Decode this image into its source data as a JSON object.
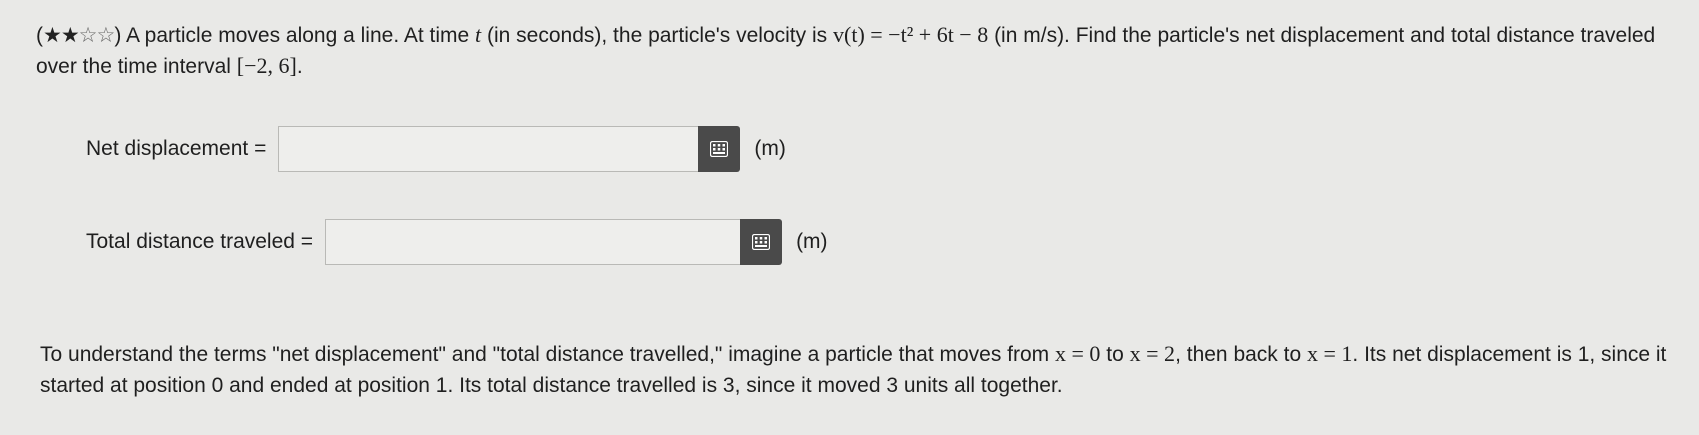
{
  "question": {
    "difficulty": {
      "filled": "★★",
      "empty": "☆☆"
    },
    "text_before_t": "A particle moves along a line. At time",
    "var_t": "t",
    "text_after_t": "(in seconds), the particle's velocity is",
    "velocity_formula": "v(t) = −t² + 6t − 8",
    "text_after_formula": "(in m/s). Find the particle's net displacement and total distance traveled over the time interval",
    "interval": "[−2, 6]",
    "end_punct": "."
  },
  "net": {
    "label": "Net displacement =",
    "value": "",
    "unit": "(m)"
  },
  "total": {
    "label": "Total distance traveled =",
    "value": "",
    "unit": "(m)"
  },
  "hint": {
    "part1": "To understand the terms \"net displacement\" and \"total distance travelled,\" imagine a particle that moves from",
    "m1": "x = 0",
    "part2": "to",
    "m2": "x = 2",
    "part3": ", then back to",
    "m3": "x = 1",
    "part4": ". Its net displacement is 1, since it started at position 0 and ended at position 1. Its total distance travelled is 3, since it moved 3 units all together."
  },
  "icons": {
    "keypad": "keypad-icon"
  }
}
